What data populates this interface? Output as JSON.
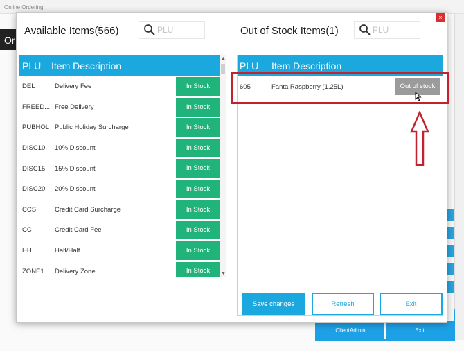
{
  "background": {
    "window_title": "Online Ordering",
    "dark_tab_label": "Or",
    "bottom_buttons": [
      "ClientAdmin",
      "Exit"
    ]
  },
  "modal": {
    "close_label": "×",
    "available": {
      "title": "Available Items(566)",
      "search_placeholder": "PLU",
      "headers": {
        "plu": "PLU",
        "desc": "Item Description"
      },
      "items": [
        {
          "plu": "DEL",
          "desc": "Delivery Fee",
          "status": "In Stock"
        },
        {
          "plu": "FREED...",
          "desc": "Free Delivery",
          "status": "In Stock"
        },
        {
          "plu": "PUBHOL",
          "desc": "Public Holiday Surcharge",
          "status": "In Stock"
        },
        {
          "plu": "DISC10",
          "desc": "10% Discount",
          "status": "In Stock"
        },
        {
          "plu": "DISC15",
          "desc": "15% Discount",
          "status": "In Stock"
        },
        {
          "plu": "DISC20",
          "desc": "20% Discount",
          "status": "In Stock"
        },
        {
          "plu": "CCS",
          "desc": "Credit Card Surcharge",
          "status": "In Stock"
        },
        {
          "plu": "CC",
          "desc": "Credit Card Fee",
          "status": "In Stock"
        },
        {
          "plu": "HH",
          "desc": "Half/Half",
          "status": "In Stock"
        },
        {
          "plu": "ZONE1",
          "desc": "Delivery Zone",
          "status": "In Stock"
        }
      ]
    },
    "out_of_stock": {
      "title": "Out of Stock Items(1)",
      "search_placeholder": "PLU",
      "headers": {
        "plu": "PLU",
        "desc": "Item Description"
      },
      "items": [
        {
          "plu": "605",
          "desc": "Fanta Raspberry (1.25L)",
          "status": "Out of stock"
        }
      ]
    },
    "buttons": {
      "save": "Save changes",
      "refresh": "Refresh",
      "exit": "Exit"
    }
  },
  "colors": {
    "header_blue": "#1aa8df",
    "in_stock_green": "#20b37a",
    "out_of_stock_gray": "#9b9b9b",
    "annotation_red": "#c3212e"
  }
}
